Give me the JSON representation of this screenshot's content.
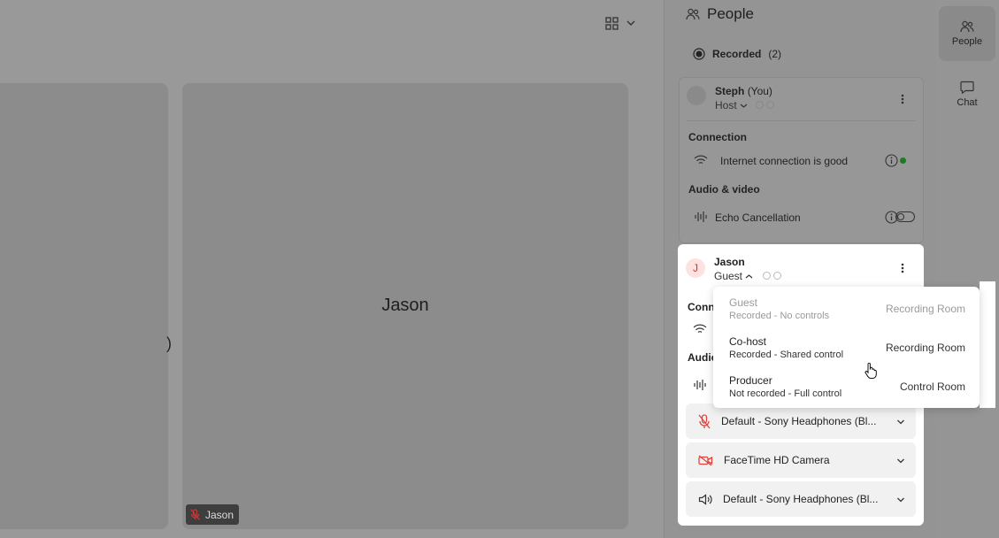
{
  "stage": {
    "left_tile_text": ")",
    "jason_tile": {
      "name": "Jason",
      "tag_name": "Jason"
    }
  },
  "panel": {
    "title": "People",
    "recorded": {
      "label": "Recorded",
      "count": "(2)"
    },
    "steph": {
      "name": "Steph",
      "you": "(You)",
      "role": "Host",
      "connection_heading": "Connection",
      "connection_text": "Internet connection is good",
      "status_color": "#1a9e2a",
      "audio_video_heading": "Audio & video",
      "echo_label": "Echo Cancellation"
    },
    "jason": {
      "avatar_letter": "J",
      "name": "Jason",
      "role": "Guest",
      "connection_heading_partial": "Conn",
      "audio_heading_partial": "Audio",
      "mic_device": "Default - Sony Headphones (Bl...",
      "camera_device": "FaceTime HD Camera",
      "speaker_device": "Default - Sony Headphones (Bl..."
    }
  },
  "rail": {
    "people_label": "People",
    "chat_label": "Chat"
  },
  "role_menu": {
    "options": [
      {
        "title": "Guest",
        "subtitle": "Recorded - No controls",
        "room": "Recording Room"
      },
      {
        "title": "Co-host",
        "subtitle": "Recorded - Shared control",
        "room": "Recording Room"
      },
      {
        "title": "Producer",
        "subtitle": "Not recorded - Full control",
        "room": "Control Room"
      }
    ]
  },
  "colors": {
    "accent_red": "#e0443e",
    "avatar_bg": "#fde2e0"
  }
}
